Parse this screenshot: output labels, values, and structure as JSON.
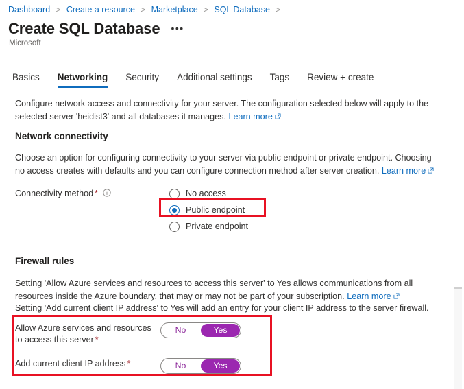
{
  "breadcrumb": {
    "items": [
      {
        "label": "Dashboard"
      },
      {
        "label": "Create a resource"
      },
      {
        "label": "Marketplace"
      },
      {
        "label": "SQL Database"
      }
    ],
    "separator": ">"
  },
  "header": {
    "title": "Create SQL Database",
    "more_label": "•••",
    "publisher": "Microsoft"
  },
  "tabs": [
    {
      "label": "Basics",
      "active": false
    },
    {
      "label": "Networking",
      "active": true
    },
    {
      "label": "Security",
      "active": false
    },
    {
      "label": "Additional settings",
      "active": false
    },
    {
      "label": "Tags",
      "active": false
    },
    {
      "label": "Review + create",
      "active": false
    }
  ],
  "intro": {
    "text": "Configure network access and connectivity for your server. The configuration selected below will apply to the selected server 'heidist3' and all databases it manages.",
    "link": "Learn more"
  },
  "network_connectivity": {
    "heading": "Network connectivity",
    "description": "Choose an option for configuring connectivity to your server via public endpoint or private endpoint. Choosing no access creates with defaults and you can configure connection method after server creation.",
    "link": "Learn more",
    "field_label": "Connectivity method",
    "required_marker": "*",
    "options": [
      {
        "label": "No access",
        "selected": false
      },
      {
        "label": "Public endpoint",
        "selected": true
      },
      {
        "label": "Private endpoint",
        "selected": false
      }
    ]
  },
  "firewall_rules": {
    "heading": "Firewall rules",
    "description_line1": "Setting 'Allow Azure services and resources to access this server' to Yes allows communications from all resources inside the Azure boundary, that may or may not be part of your subscription.",
    "link": "Learn more",
    "description_line2": "Setting 'Add current client IP address' to Yes will add an entry for your client IP address to the server firewall.",
    "toggles": [
      {
        "label": "Allow Azure services and resources to access this server",
        "required_marker": "*",
        "off_label": "No",
        "on_label": "Yes",
        "value": "Yes"
      },
      {
        "label": "Add current client IP address",
        "required_marker": "*",
        "off_label": "No",
        "on_label": "Yes",
        "value": "Yes"
      }
    ]
  },
  "colors": {
    "link": "#0f6cbd",
    "accent": "#0f6cbd",
    "toggle_on": "#9b27b0",
    "required": "#a4262c",
    "annotation": "#e81123"
  }
}
